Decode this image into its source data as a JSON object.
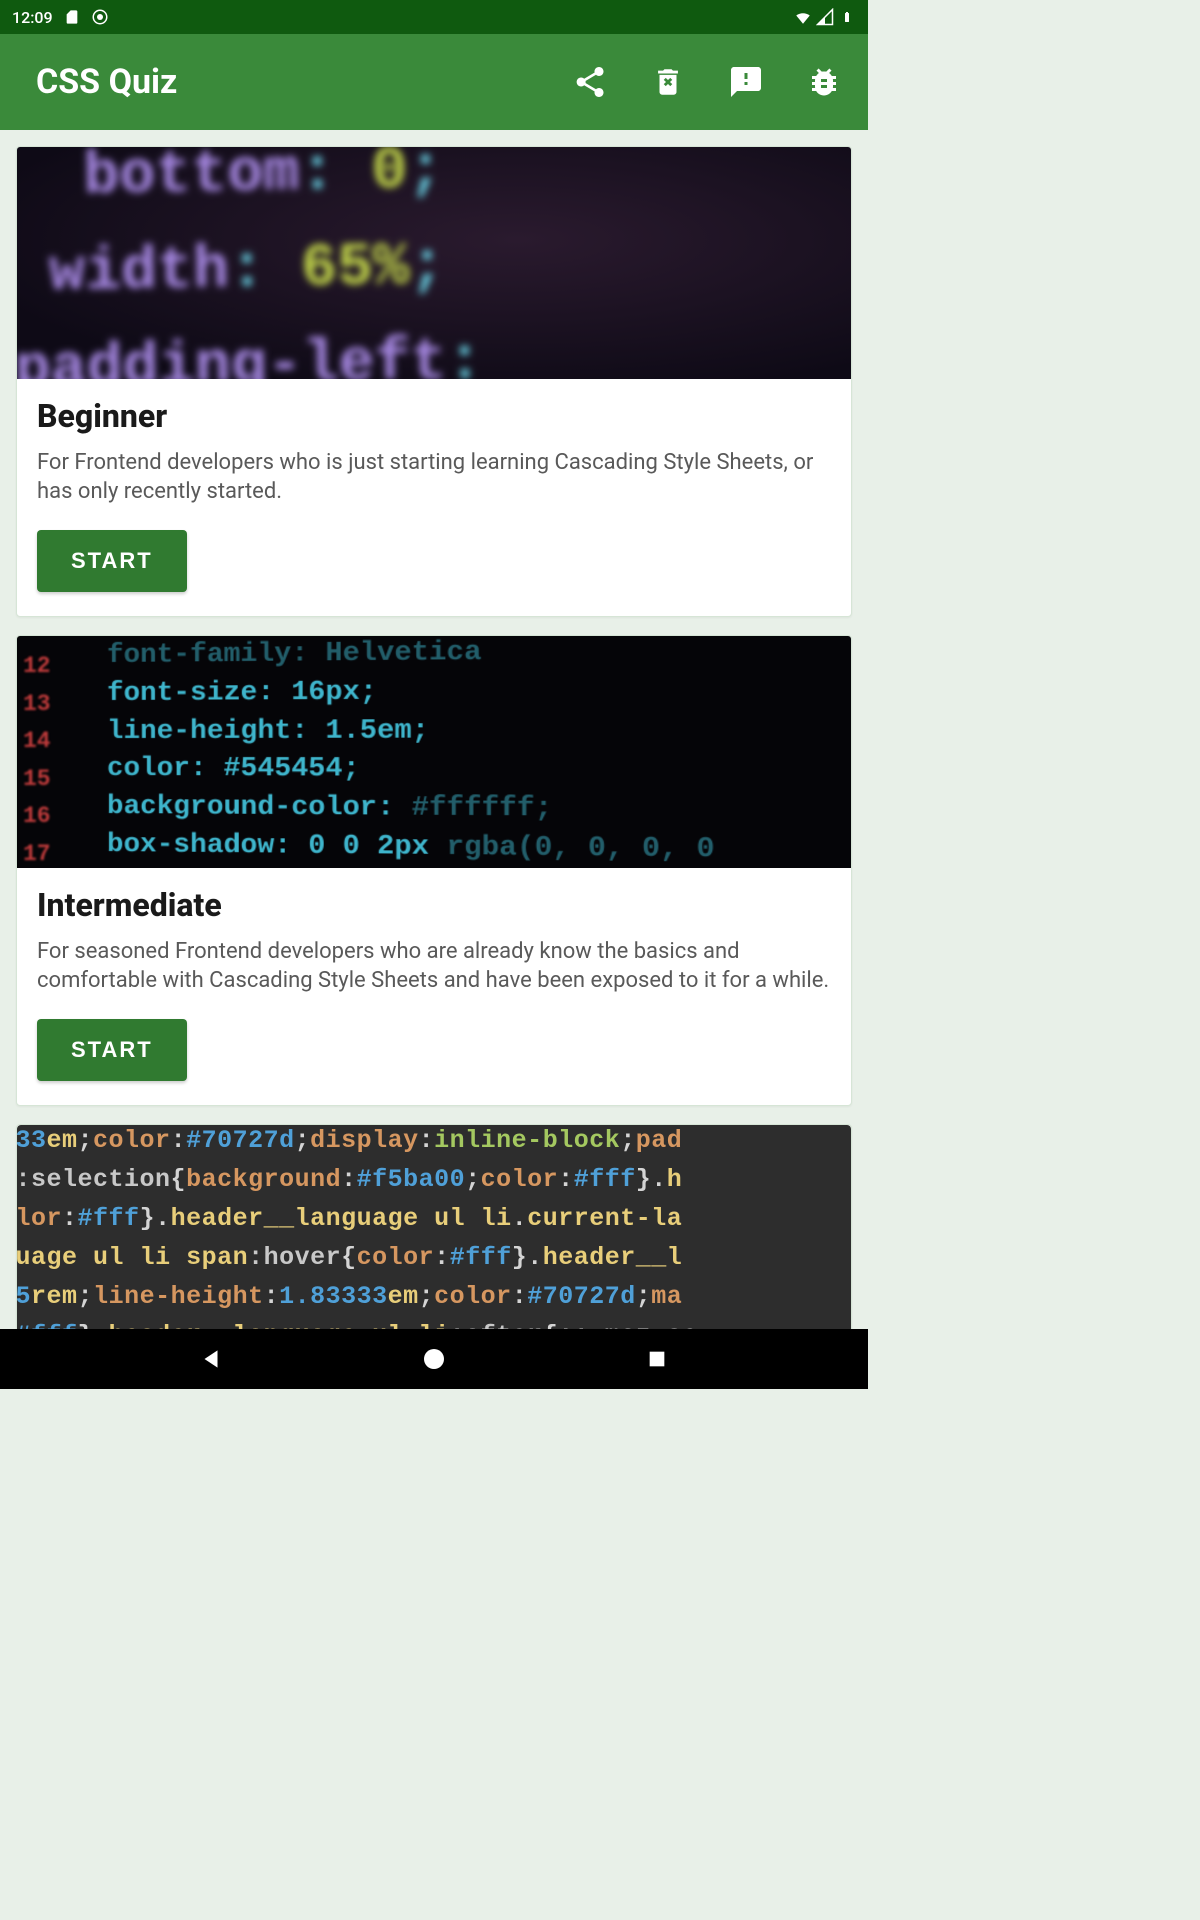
{
  "status": {
    "time": "12:09"
  },
  "app": {
    "title": "CSS Quiz"
  },
  "cards": [
    {
      "title": "Beginner",
      "desc": "For Frontend developers who is just starting learning Cascading Style Sheets, or has only recently started.",
      "button": "START"
    },
    {
      "title": "Intermediate",
      "desc": "For seasoned Frontend developers who are already know the basics and comfortable with Cascading Style Sheets and have been exposed to it for a while.",
      "button": "START"
    }
  ]
}
